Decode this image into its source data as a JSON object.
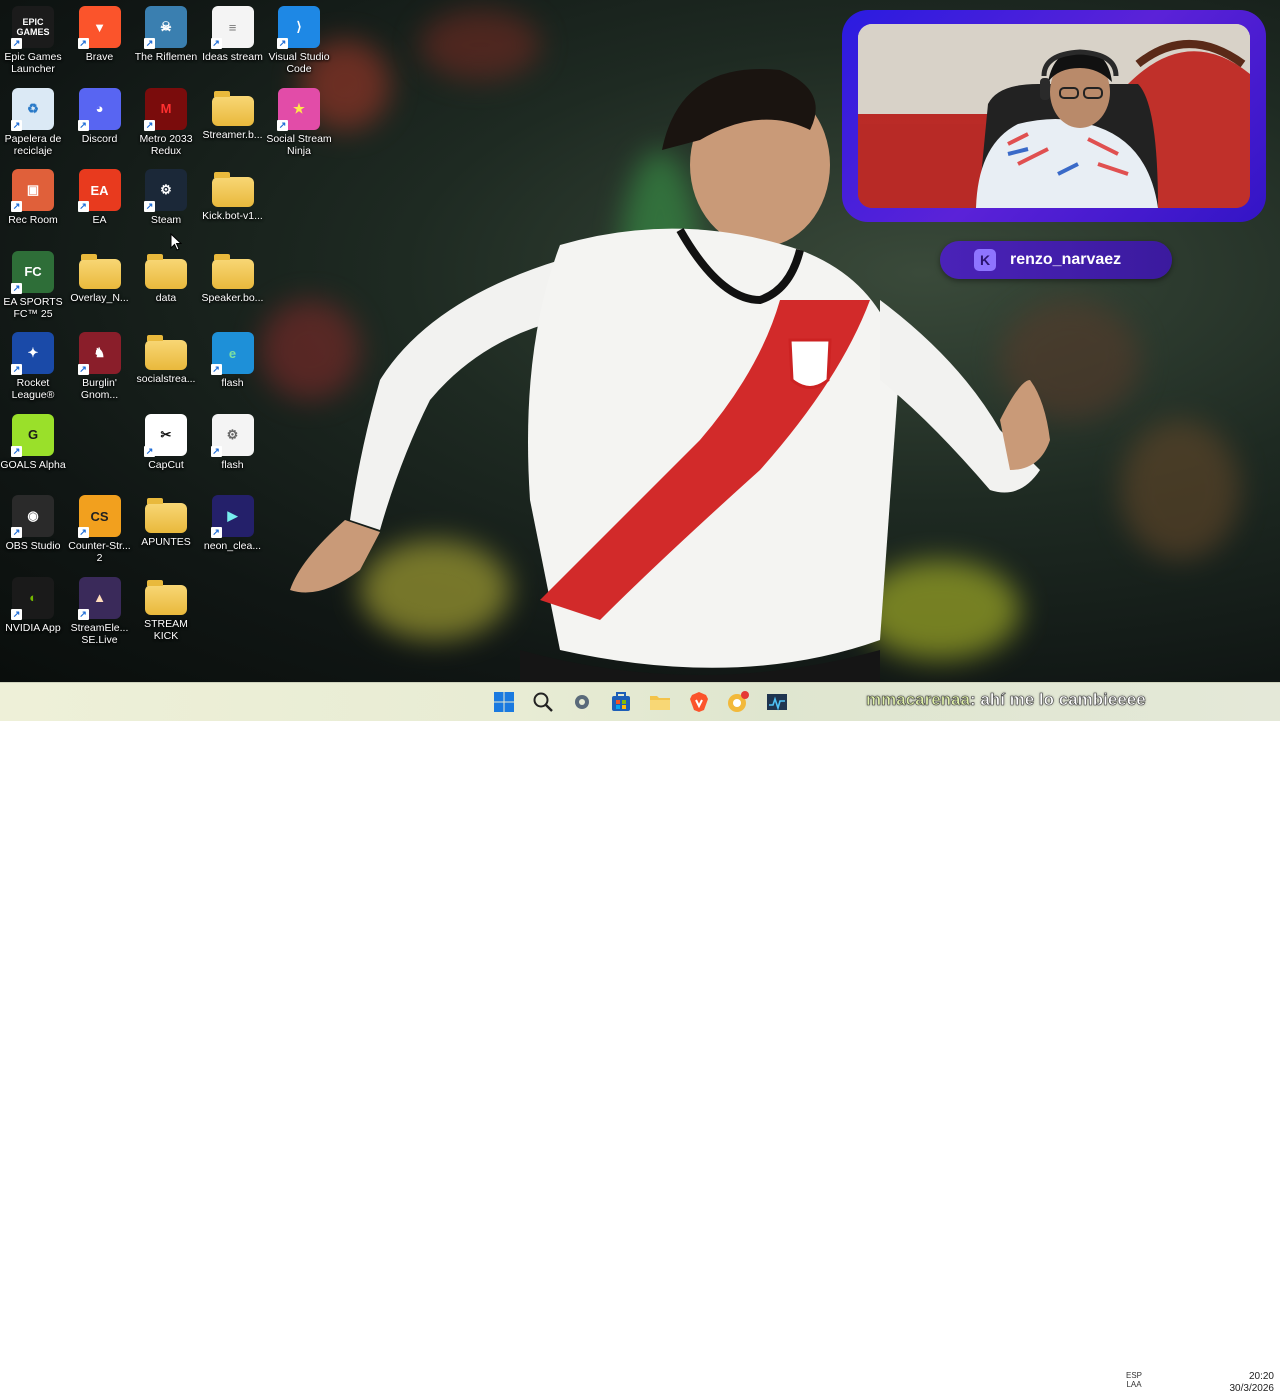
{
  "desktop": {
    "icons": [
      {
        "label": "Epic Games\nLauncher",
        "icon": "epic-games-icon"
      },
      {
        "label": "Brave",
        "icon": "brave-icon"
      },
      {
        "label": "The Riflemen",
        "icon": "riflemen-icon"
      },
      {
        "label": "Ideas stream",
        "icon": "text-file-icon"
      },
      {
        "label": "Visual Studio\nCode",
        "icon": "vscode-icon"
      },
      {
        "label": "Papelera de\nreciclaje",
        "icon": "recycle-bin-icon"
      },
      {
        "label": "Discord",
        "icon": "discord-icon"
      },
      {
        "label": "Metro 2033\nRedux",
        "icon": "metro-icon"
      },
      {
        "label": "Streamer.b...",
        "icon": "folder-icon"
      },
      {
        "label": "Social Stream\nNinja",
        "icon": "social-stream-ninja-icon"
      },
      {
        "label": "Rec Room",
        "icon": "rec-room-icon"
      },
      {
        "label": "EA",
        "icon": "ea-icon"
      },
      {
        "label": "Steam",
        "icon": "steam-icon"
      },
      {
        "label": "Kick.bot-v1...",
        "icon": "folder-icon"
      },
      {
        "label": "EA SPORTS\nFC™ 25",
        "icon": "ea-fc-icon"
      },
      {
        "label": "Overlay_N...",
        "icon": "folder-icon"
      },
      {
        "label": "data",
        "icon": "folder-icon"
      },
      {
        "label": "Speaker.bo...",
        "icon": "folder-icon"
      },
      {
        "label": "Rocket\nLeague®",
        "icon": "rocket-league-icon"
      },
      {
        "label": "Burglin'\nGnom...",
        "icon": "burglin-gnomes-icon"
      },
      {
        "label": "socialstrea...",
        "icon": "folder-icon"
      },
      {
        "label": "flash",
        "icon": "edge-icon"
      },
      {
        "label": "GOALS Alpha",
        "icon": "goals-icon"
      },
      {
        "label": "CapCut",
        "icon": "capcut-icon"
      },
      {
        "label": "flash",
        "icon": "settings-file-icon"
      },
      {
        "label": "OBS Studio",
        "icon": "obs-icon"
      },
      {
        "label": "Counter-Str...\n2",
        "icon": "counter-strike-icon"
      },
      {
        "label": "APUNTES",
        "icon": "folder-icon"
      },
      {
        "label": "neon_clea...",
        "icon": "video-file-icon"
      },
      {
        "label": "NVIDIA App",
        "icon": "nvidia-icon"
      },
      {
        "label": "StreamEle...\nSE.Live",
        "icon": "streamelements-icon"
      },
      {
        "label": "STREAM\nKICK",
        "icon": "folder-icon"
      }
    ],
    "epic_text": "EPIC\nGAMES"
  },
  "stream_overlay": {
    "kick_logo": "K",
    "username": "renzo_narvaez",
    "chat_user": "mmacarenaa",
    "chat_message": ": ahí me lo cambieeee"
  },
  "taskbar": {
    "icons": [
      "windows-start-icon",
      "search-icon",
      "settings-icon",
      "store-icon",
      "file-explorer-icon",
      "brave-icon",
      "chrome-canary-icon",
      "task-manager-icon"
    ],
    "language_line1": "ESP",
    "language_line2": "LAA",
    "time": "20:20",
    "date": "30/3/2026"
  },
  "colors": {
    "webcam_frame": "#3b1cd8",
    "kick_pill": "#4a22b8",
    "taskbar": "#e8ecd4"
  }
}
